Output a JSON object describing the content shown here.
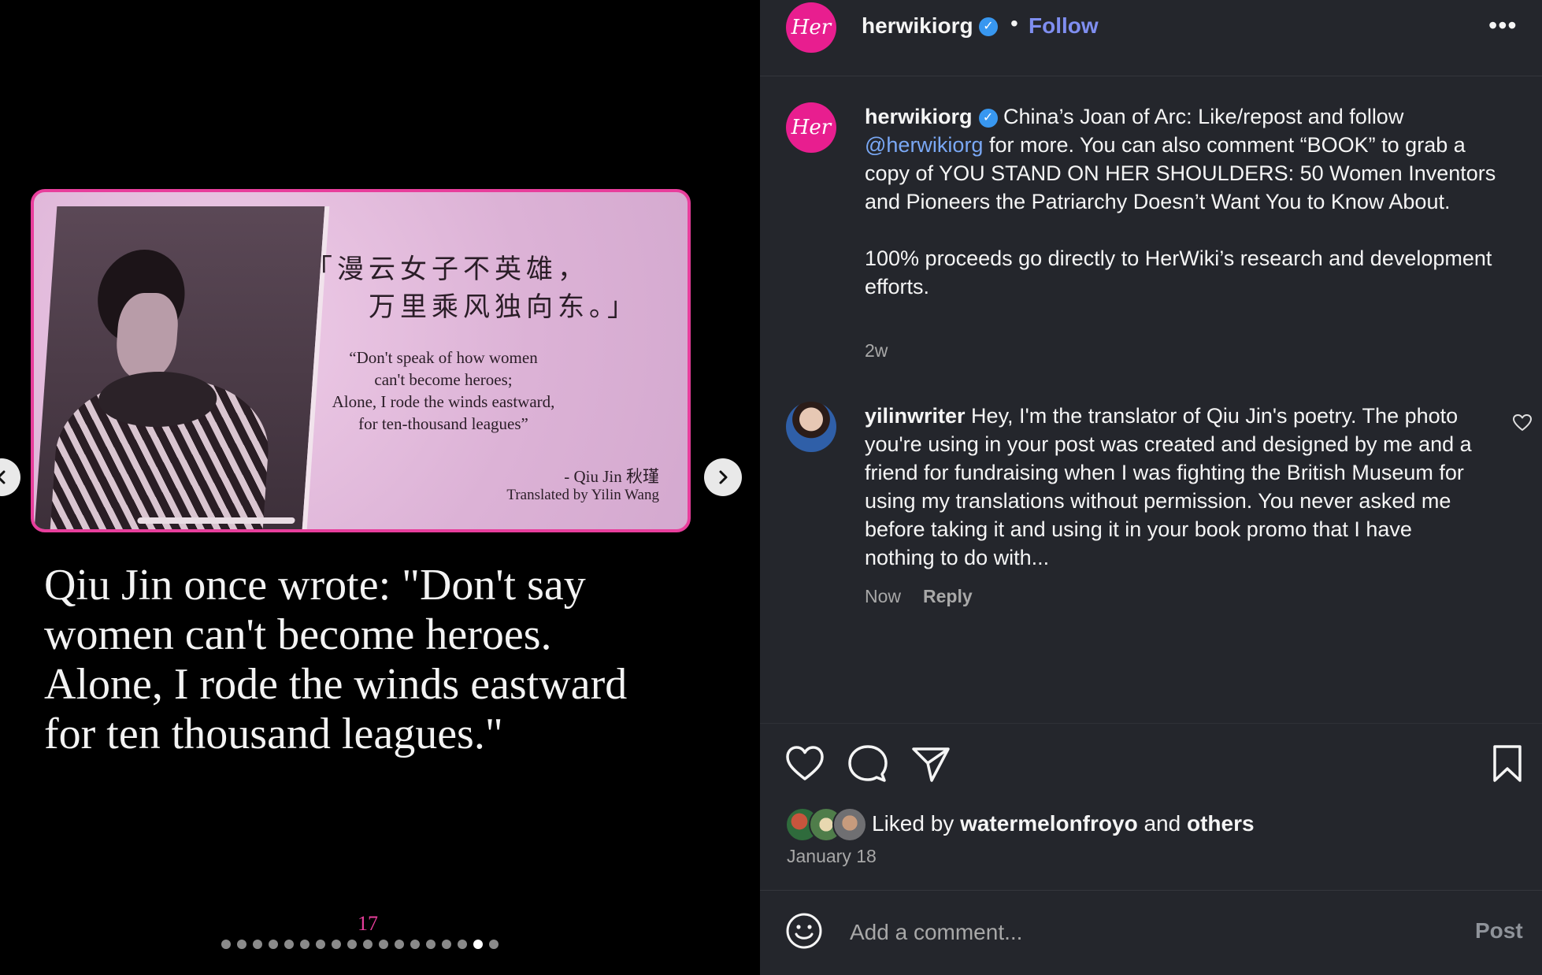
{
  "media": {
    "card": {
      "chinese_line_1": "「漫云女子不英雄，",
      "chinese_line_2": "万里乘风独向东。」",
      "quote_lines": [
        "“Don't speak of how women",
        "can't become heroes;",
        "Alone, I rode the winds eastward,",
        "for ten-thousand leagues”"
      ],
      "attribution": "- Qiu Jin 秋瑾",
      "translator": "Translated by Yilin Wang"
    },
    "caption_lines": [
      "Qiu Jin once wrote: \"Don't say",
      "women can't become heroes.",
      "Alone, I rode the winds eastward",
      "for ten thousand leagues.\""
    ],
    "slide_number": "17",
    "dots_total": 18,
    "dots_active_index": 16,
    "prev_icon": "chevron-left-icon",
    "next_icon": "chevron-right-icon"
  },
  "header": {
    "avatar_text": "Her",
    "username": "herwikiorg",
    "separator": "•",
    "follow_label": "Follow",
    "more_label": "•••"
  },
  "post": {
    "username": "herwikiorg",
    "text_before_mention": " China’s Joan of Arc: Like/repost and follow ",
    "mention": "@herwikiorg",
    "text_after_mention": " for more. You can also comment “BOOK” to grab a copy of YOU STAND ON HER SHOULDERS: 50 Women Inventors and Pioneers the Patriarchy Doesn’t Want You to Know About.",
    "paragraph_2": "100% proceeds go directly to HerWiki’s research and development efforts.",
    "time": "2w"
  },
  "comment": {
    "username": "yilinwriter",
    "text": " Hey, I'm the translator of Qiu Jin's poetry. The photo you're using in your post was created and designed by me and a friend for fundraising when I was fighting the British Museum for using my translations without permission. You never asked me before taking it and using it in your book promo that I have nothing to do with...",
    "time": "Now",
    "reply_label": "Reply"
  },
  "likes": {
    "prefix": "Liked by ",
    "user": "watermelonfroyo",
    "middle": " and ",
    "others": "others",
    "date": "January 18"
  },
  "composer": {
    "placeholder": "Add a comment...",
    "post_label": "Post"
  },
  "colors": {
    "accent_pink": "#e83e9c",
    "link_blue": "#7f8ef0",
    "verified_blue": "#3897f0",
    "panel_bg": "#24262c"
  }
}
